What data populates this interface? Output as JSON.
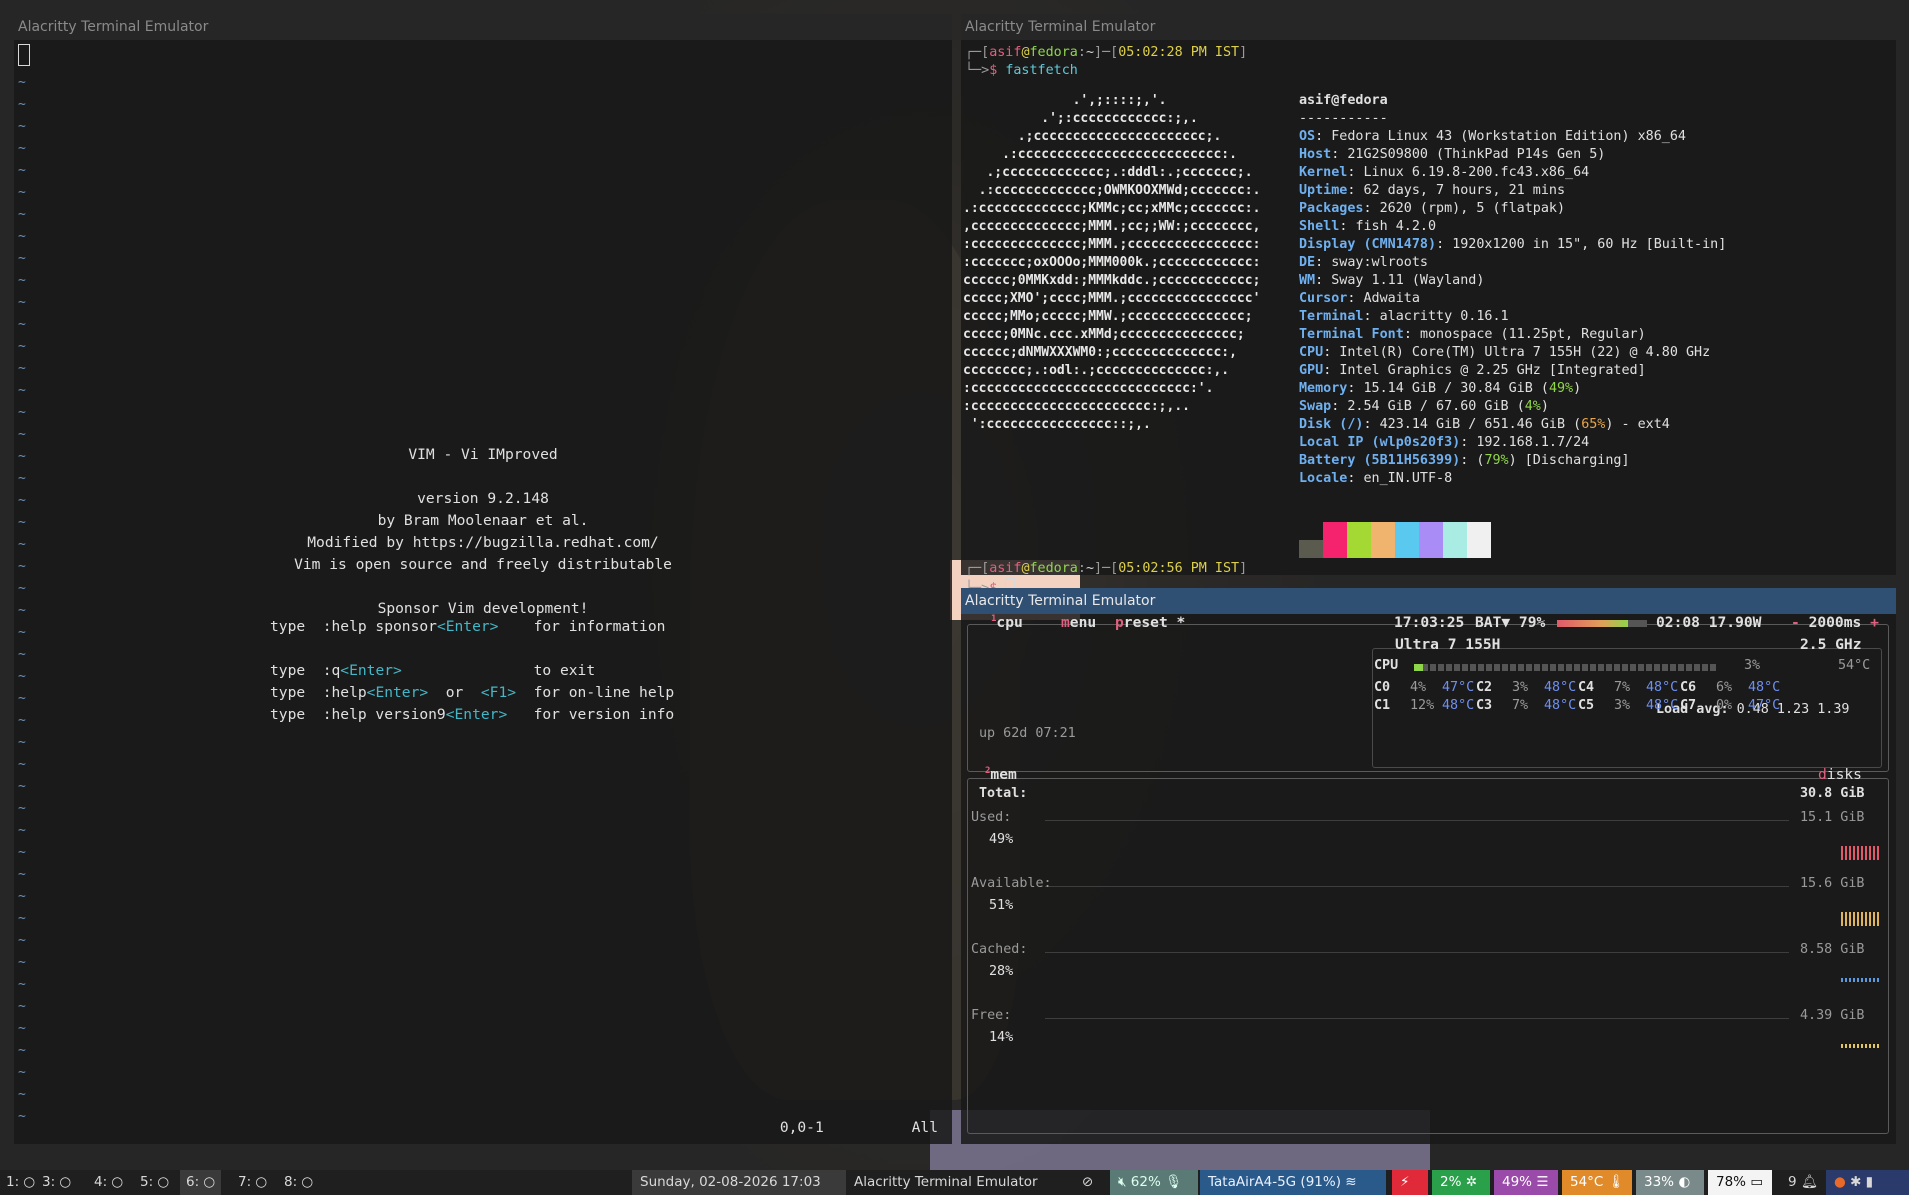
{
  "colors": {
    "accent": "#2f4f73",
    "green": "#8fd64a",
    "red": "#e0607e",
    "yellow": "#ddd04a"
  },
  "vim": {
    "title": "Alacritty Terminal Emulator",
    "intro": [
      "VIM - Vi IMproved",
      "",
      "version 9.2.148",
      "by Bram Moolenaar et al.",
      "Modified by https://bugzilla.redhat.com/",
      "Vim is open source and freely distributable",
      "",
      "Sponsor Vim development!"
    ],
    "help": [
      {
        "a": "type  :help sponsor",
        "k": "<Enter>",
        "b": "    for information",
        "k2": "",
        "c": ""
      },
      {
        "a": "",
        "k": "",
        "b": "",
        "k2": "",
        "c": ""
      },
      {
        "a": "type  :q",
        "k": "<Enter>",
        "b": "               to exit",
        "k2": "",
        "c": ""
      },
      {
        "a": "type  :help",
        "k": "<Enter>",
        "b": "  or  ",
        "k2": "<F1>",
        "c": "  for on-line help"
      },
      {
        "a": "type  :help version9",
        "k": "<Enter>",
        "b": "   for version info",
        "k2": "",
        "c": ""
      }
    ],
    "ruler": "0,0-1",
    "position": "All"
  },
  "fastfetch": {
    "title": "Alacritty Terminal Emulator",
    "user": "asif",
    "host": "fedora",
    "cwd": "~",
    "time1": "05:02:28 PM IST",
    "time2": "05:02:56 PM IST",
    "command": "fastfetch",
    "logo": "              .',;::::;,'.\n          .';:cccccccccccc:;,.\n       .;cccccccccccccccccccccc;.\n     .:cccccccccccccccccccccccccc:.\n   .;ccccccccccccc;.:dddl:.;ccccccc;.\n  .:ccccccccccccc;OWMKOOXMWd;ccccccc:.\n.:ccccccccccccc;KMMc;cc;xMMc;ccccccc:.\n,cccccccccccccc;MMM.;cc;;WW:;cccccccc,\n:cccccccccccccc;MMM.;cccccccccccccccc:\n:ccccccc;oxOOOo;MMM000k.;cccccccccccc:\ncccccc;0MMKxdd:;MMMkddc.;cccccccccccc;\nccccc;XMO';cccc;MMM.;cccccccccccccccc'\nccccc;MMo;ccccc;MMW.;ccccccccccccccc;\nccccc;0MNc.ccc.xMMd;ccccccccccccccc;\ncccccc;dNMWXXXWM0:;cccccccccccccc:,\ncccccccc;.:odl:.;cccccccccccccc:,.\n:cccccccccccccccccccccccccccc:'.\n:ccccccccccccccccccccccc:;,..\n ':cccccccccccccccc::;,.",
    "header": "asif@fedora",
    "sep": "-----------",
    "info": [
      {
        "k": "OS",
        "v": "Fedora Linux 43 (Workstation Edition) x86_64"
      },
      {
        "k": "Host",
        "v": "21G2S09800 (ThinkPad P14s Gen 5)"
      },
      {
        "k": "Kernel",
        "v": "Linux 6.19.8-200.fc43.x86_64"
      },
      {
        "k": "Uptime",
        "v": "62 days, 7 hours, 21 mins"
      },
      {
        "k": "Packages",
        "v": "2620 (rpm), 5 (flatpak)"
      },
      {
        "k": "Shell",
        "v": "fish 4.2.0"
      },
      {
        "k": "Display (CMN1478)",
        "v": "1920x1200 in 15\", 60 Hz [Built-in]"
      },
      {
        "k": "DE",
        "v": "sway:wlroots"
      },
      {
        "k": "WM",
        "v": "Sway 1.11 (Wayland)"
      },
      {
        "k": "Cursor",
        "v": "Adwaita"
      },
      {
        "k": "Terminal",
        "v": "alacritty 0.16.1"
      },
      {
        "k": "Terminal Font",
        "v": "monospace (11.25pt, Regular)"
      },
      {
        "k": "CPU",
        "v": "Intel(R) Core(TM) Ultra 7 155H (22) @ 4.80 GHz"
      },
      {
        "k": "GPU",
        "v": "Intel Graphics @ 2.25 GHz [Integrated]"
      },
      {
        "k": "Memory",
        "v": "15.14 GiB / 30.84 GiB",
        "p": "49%"
      },
      {
        "k": "Swap",
        "v": "2.54 GiB / 67.60 GiB",
        "p": "4%"
      },
      {
        "k": "Disk (/)",
        "v": "423.14 GiB / 651.46 GiB",
        "p": "65%",
        "tail": " - ext4"
      },
      {
        "k": "Local IP (wlp0s20f3)",
        "v": "192.168.1.7/24"
      },
      {
        "k": "Battery (5B11H56399)",
        "v": "",
        "p": "79%",
        "tail": " [Discharging]"
      },
      {
        "k": "Locale",
        "v": "en_IN.UTF-8"
      }
    ],
    "swatches": [
      "#5a5a4f",
      "#f5226d",
      "#a4d933",
      "#f0b46e",
      "#59c9f0",
      "#a98cf5",
      "#a8ece3",
      "#f0f0f0"
    ]
  },
  "btop": {
    "title": "Alacritty Terminal Emulator",
    "tabs": {
      "cpu_num": "1",
      "cpu": "cpu",
      "menu": "menu",
      "preset": "preset *"
    },
    "clock": "17:03:25",
    "bat_label": "BAT▼ 79%",
    "bat_time": "02:08 17.90W",
    "interval": "2000ms",
    "cpu_name": "Ultra 7 155H",
    "freq": "2.5 GHz",
    "cpu_total": {
      "label": "CPU",
      "pct": "3%",
      "temp": "54°C",
      "level": 0.03
    },
    "cores": [
      {
        "n": "C0",
        "p": "4%",
        "t": "47°C"
      },
      {
        "n": "C2",
        "p": "3%",
        "t": "48°C"
      },
      {
        "n": "C4",
        "p": "7%",
        "t": "48°C"
      },
      {
        "n": "C6",
        "p": "6%",
        "t": "48°C"
      },
      {
        "n": "C1",
        "p": "12%",
        "t": "48°C"
      },
      {
        "n": "C3",
        "p": "7%",
        "t": "48°C"
      },
      {
        "n": "C5",
        "p": "3%",
        "t": "48°C"
      },
      {
        "n": "C7",
        "p": "0%",
        "t": "47°C"
      }
    ],
    "load_label": "Load avg:",
    "load": "0.48 1.23 1.39",
    "uptime": "up 62d 07:21",
    "mem_num": "2",
    "mem": "mem",
    "disks": "disks",
    "total_label": "Total:",
    "total": "30.8 GiB",
    "stats": [
      {
        "label": "Used:",
        "pct": "49%",
        "val": "15.1 GiB",
        "color": "#e05a6a"
      },
      {
        "label": "Available:",
        "pct": "51%",
        "val": "15.6 GiB",
        "color": "#e0b45a"
      },
      {
        "label": "Cached:",
        "pct": "28%",
        "val": "8.58 GiB",
        "color": "#5a9ae0"
      },
      {
        "label": "Free:",
        "pct": "14%",
        "val": "4.39 GiB",
        "color": "#e0c85a"
      }
    ]
  },
  "bar": {
    "workspaces": [
      "1:",
      "3:",
      "4:",
      "5:",
      "6:",
      "7:",
      "8:"
    ],
    "datetime": "Sunday, 02-08-2026 17:03",
    "window_title": "Alacritty Terminal Emulator",
    "volume": "62%",
    "wifi": "TataAirA4-5G (91%)",
    "cpu": "2%",
    "memory": "49%",
    "temp": "54°C",
    "brightness": "33%",
    "battery": "78%",
    "notifications": "9"
  }
}
